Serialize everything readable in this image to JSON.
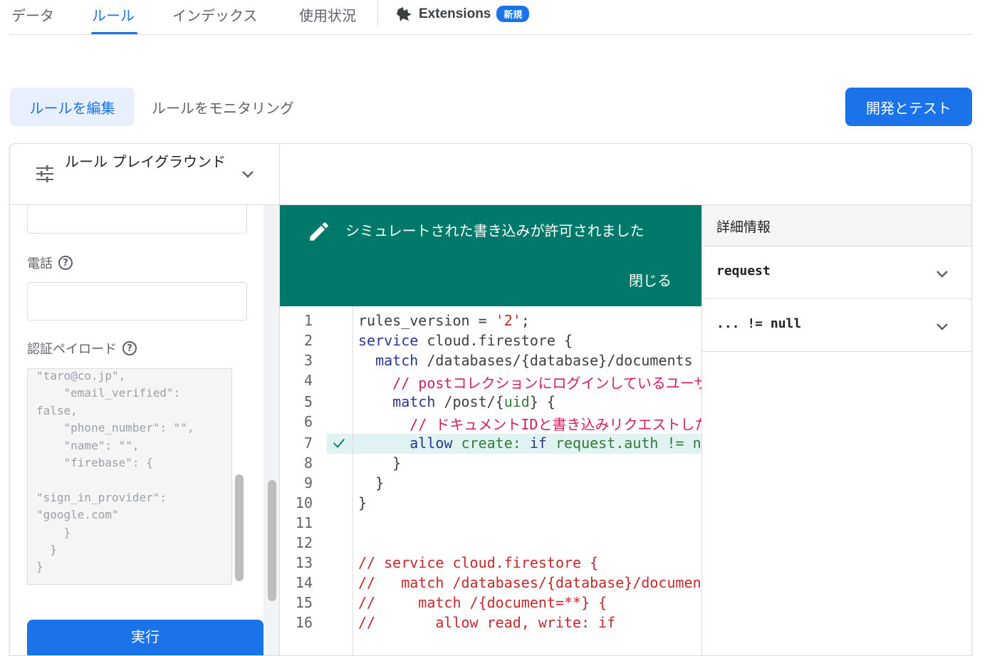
{
  "topnav": {
    "tabs": [
      "データ",
      "ルール",
      "インデックス",
      "使用状況"
    ],
    "active_tab": "ルール",
    "extensions_label": "Extensions",
    "extensions_badge": "新規"
  },
  "subtabs": {
    "edit": "ルールを編集",
    "monitor": "ルールをモニタリング"
  },
  "dev_button": "開発とテスト",
  "playground": {
    "title": "ルール プレイグラウンド",
    "phone_label": "電話",
    "payload_label": "認証ペイロード",
    "payload_text": "\"taro@co.jp\",\n    \"email_verified\":\nfalse,\n    \"phone_number\": \"\",\n    \"name\": \"\",\n    \"firebase\": {\n\n\"sign_in_provider\":\n\"google.com\"\n    }\n  }\n}",
    "run_button": "実行"
  },
  "banner": {
    "message": "シミュレートされた書き込みが許可されました",
    "close": "閉じる"
  },
  "editor": {
    "line_numbers": [
      "1",
      "2",
      "3",
      "4",
      "5",
      "6",
      "7",
      "8",
      "9",
      "10",
      "11",
      "12",
      "13",
      "14",
      "15",
      "16"
    ],
    "lines": {
      "l1a": "rules_version = ",
      "l1b": "'2'",
      "l1c": ";",
      "l2a": "service",
      "l2b": " cloud.firestore {",
      "l3a": "  match",
      "l3b": " /databases/{database}/documents {",
      "l4": "    // postコレクションにログインしているユーザーのみ作成できる",
      "l5a": "    match",
      "l5b": " /post/{",
      "l5c": "uid",
      "l5d": "} {",
      "l6": "      // ドキュメントIDと書き込みリクエストした認証ユーザーのIDが一致",
      "l7a": "      allow",
      "l7b": " create: ",
      "l7c": "if",
      "l7d": " request.auth != null;",
      "l8": "    }",
      "l9": "  }",
      "l10": "}",
      "l13": "// service cloud.firestore {",
      "l14": "//   match /databases/{database}/documents {",
      "l15": "//     match /{document=**} {",
      "l16": "//       allow read, write: if"
    }
  },
  "details": {
    "header": "詳細情報",
    "rows": [
      "request",
      "... != null"
    ]
  }
}
